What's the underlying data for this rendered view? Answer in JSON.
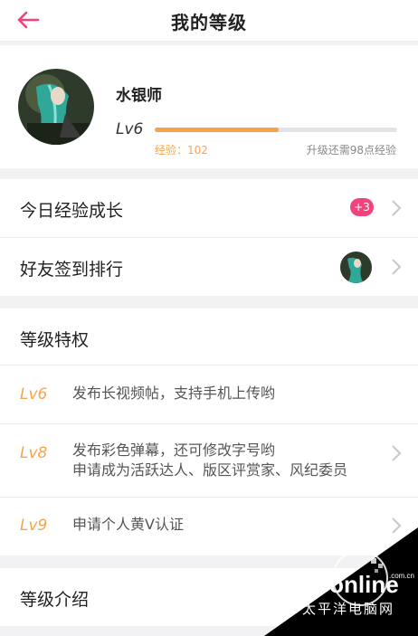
{
  "header": {
    "title": "我的等级"
  },
  "profile": {
    "username": "水银师",
    "level": "Lv6",
    "experience_label": "经验：102",
    "remaining_label": "升级还需98点经验",
    "progress_fraction": 0.51
  },
  "rows": {
    "daily": {
      "label": "今日经验成长",
      "badge": "+3"
    },
    "friends": {
      "label": "好友签到排行"
    }
  },
  "privileges": {
    "title": "等级特权",
    "items": [
      {
        "level": "Lv6",
        "lines": [
          "发布长视频帖，支持手机上传哟"
        ]
      },
      {
        "level": "Lv8",
        "lines": [
          "发布彩色弹幕，还可修改字号哟",
          "申请成为活跃达人、版区评赏家、风纪委员"
        ]
      },
      {
        "level": "Lv9",
        "lines": [
          "申请个人黄V认证"
        ]
      }
    ]
  },
  "intro": {
    "label": "等级介绍"
  },
  "watermark": {
    "text": "PConline",
    "sub": "太平洋电脑网",
    "domain": ".com.cn"
  },
  "colors": {
    "accent": "#f2437c",
    "level": "#f5a54e",
    "progress": "#f8a24c"
  },
  "icons": {
    "back": "arrow-left-icon",
    "chevron": "chevron-right-icon"
  }
}
